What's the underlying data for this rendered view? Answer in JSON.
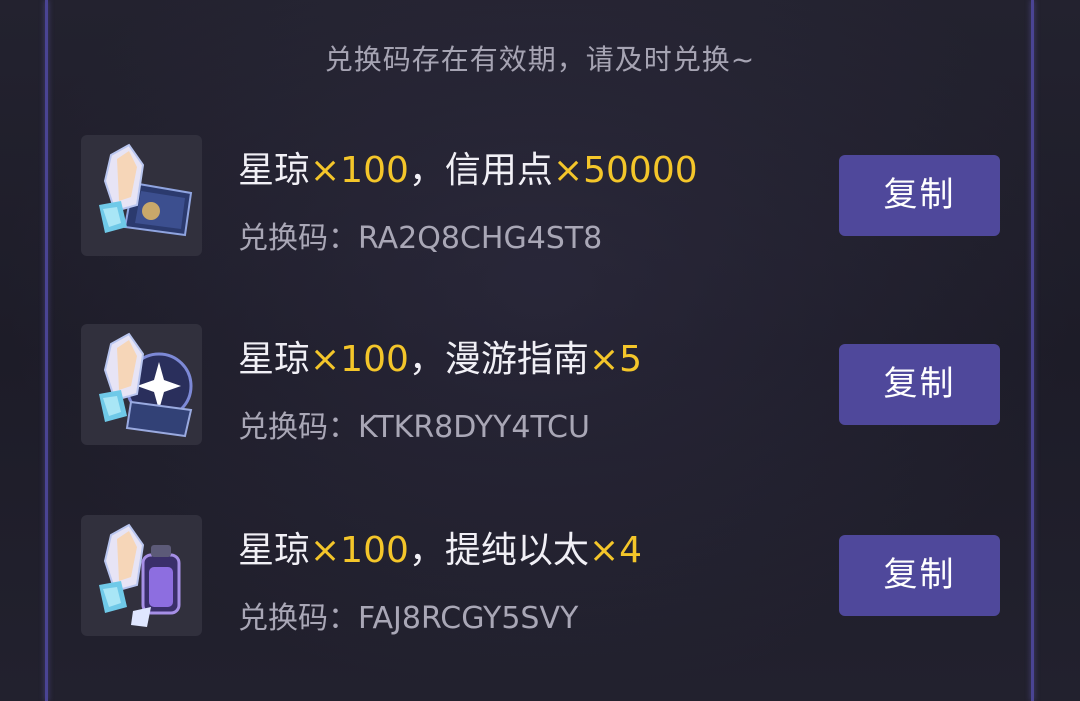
{
  "notice": "兑换码存在有效期，请及时兑换~",
  "code_prefix": "兑换码：",
  "copy_label": "复制",
  "colors": {
    "accent": "#4f489b",
    "highlight": "#f4c62a",
    "frame": "#4a4494"
  },
  "items": [
    {
      "name1": "星琼",
      "qty1": "×100",
      "sep": "，",
      "name2": "信用点",
      "qty2": "×50000",
      "code": "RA2Q8CHG4ST8",
      "icon": "crystal-and-credit-card-icon"
    },
    {
      "name1": "星琼",
      "qty1": "×100",
      "sep": "，",
      "name2": "漫游指南",
      "qty2": "×5",
      "code": "KTKR8DYY4TCU",
      "icon": "crystal-and-guidebook-icon"
    },
    {
      "name1": "星琼",
      "qty1": "×100",
      "sep": "，",
      "name2": "提纯以太",
      "qty2": "×4",
      "code": "FAJ8RCGY5SVY",
      "icon": "crystal-and-ether-vial-icon"
    }
  ]
}
